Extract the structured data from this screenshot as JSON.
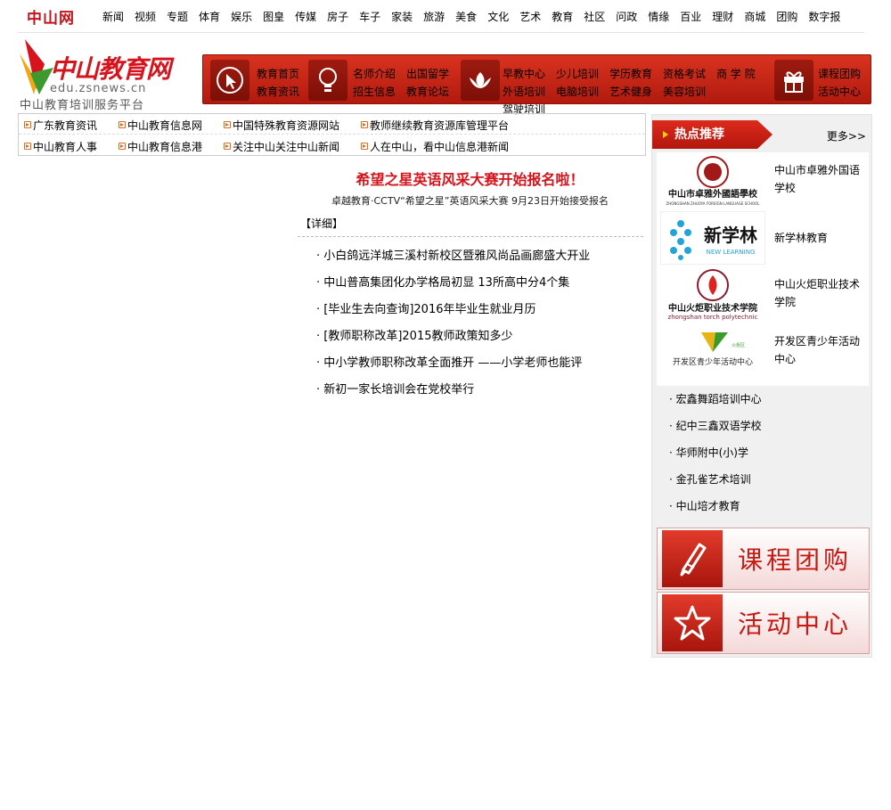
{
  "topnav": {
    "logo": "中山网",
    "items": [
      "新闻",
      "视频",
      "专题",
      "体育",
      "娱乐",
      "图皇",
      "传媒",
      "房子",
      "车子",
      "家装",
      "旅游",
      "美食",
      "文化",
      "艺术",
      "教育",
      "社区",
      "问政",
      "情缘",
      "百业",
      "理财",
      "商城",
      "团购",
      "数字报"
    ]
  },
  "logo": {
    "title": "中山教育网",
    "url": "edu.zsnews.cn",
    "slogan": "中山教育培训服务平台"
  },
  "rednav": {
    "groups": [
      [
        "教育首页",
        "教育资讯"
      ],
      [
        "名师介绍",
        "招生信息",
        "出国留学",
        "教育论坛"
      ],
      [
        "早教中心",
        "外语培训",
        "少儿培训",
        "电脑培训",
        "学历教育",
        "艺术健身",
        "资格考试",
        "美容培训",
        "商 学 院",
        "驾驶培训"
      ],
      [
        "课程团购",
        "活动中心"
      ]
    ]
  },
  "quicklinks": [
    [
      "广东教育资讯",
      "中山教育信息网",
      "中国特殊教育资源网站",
      "教师继续教育资源库管理平台"
    ],
    [
      "中山教育人事",
      "中山教育信息港",
      "关注中山关注中山新闻",
      "人在中山，看中山信息港新闻"
    ]
  ],
  "headline": {
    "title": "希望之星英语风采大赛开始报名啦！",
    "subtitle": "卓越教育·CCTV“希望之星”英语风采大赛 9月23日开始接受报名",
    "detail": "【详细】"
  },
  "news": [
    "· 小白鸽远洋城三溪村新校区暨雅风尚品画廊盛大开业",
    "· 中山普高集团化办学格局初显 13所高中分4个集",
    "· [毕业生去向查询]2016年毕业生就业月历",
    "· [教师职称改革]2015教师政策知多少",
    "· 中小学教师职称改革全面推开 ——小学老师也能评",
    "· 新初一家长培训会在党校举行"
  ],
  "hot": {
    "tab": "热点推荐",
    "more": "更多>>",
    "items": [
      {
        "name": "中山市卓雅外国语学校",
        "logo_text": "中山市卓雅外國語學校",
        "logo_sub": "ZHONGSHAN ZHUOYA FOREIGN LANGUAGE SCHOOL"
      },
      {
        "name": "新学林教育",
        "logo_text": "新学林",
        "logo_sub": "NEW LEARNING"
      },
      {
        "name": "中山火炬职业技术学院",
        "logo_text": "中山火炬职业技术学院",
        "logo_sub": "zhongshan torch polytechnic"
      },
      {
        "name": "开发区青少年活动中心",
        "logo_text": "开发区青少年活动中心",
        "logo_sub": "火炬区"
      }
    ],
    "textlinks": [
      "· 宏鑫舞蹈培训中心",
      "· 纪中三鑫双语学校",
      "· 华师附中(小)学",
      "· 金孔雀艺术培训",
      "· 中山培才教育"
    ]
  },
  "banners": [
    "课程团购",
    "活动中心"
  ],
  "colors": {
    "brand_red": "#d3141c",
    "nav_red": "#c42618"
  }
}
